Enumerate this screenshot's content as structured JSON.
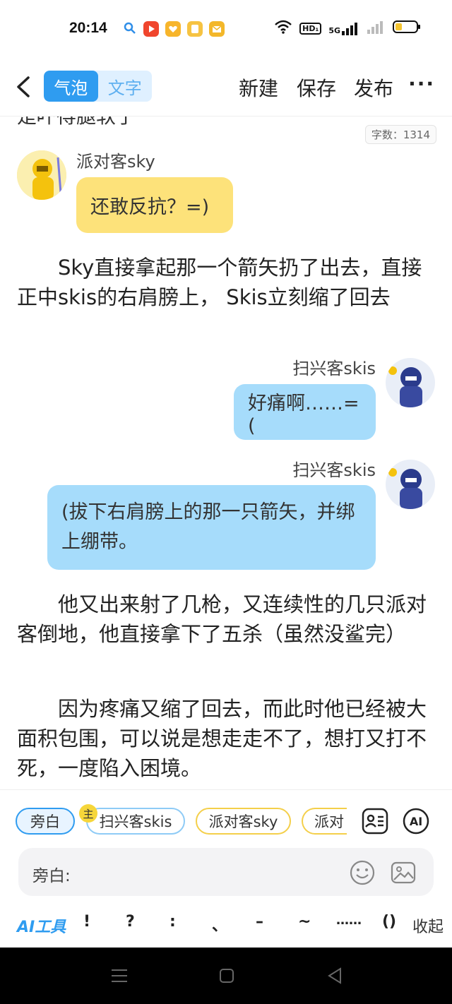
{
  "status": {
    "time": "20:14",
    "hd": "HD₁",
    "net": "5G"
  },
  "header": {
    "mode_bubble": "气泡",
    "mode_text": "文字",
    "new": "新建",
    "save": "保存",
    "publish": "发布",
    "more": "···"
  },
  "content": {
    "cut_line": "是吓得腿软了",
    "word_count": "字数：1314",
    "messages": [
      {
        "speaker": "派对客sky",
        "text": "还敢反抗？=)"
      },
      {
        "narration": "　　Sky直接拿起那一个箭矢扔了出去，直接正中skis的右肩膀上， Skis立刻缩了回去"
      },
      {
        "speaker": "扫兴客skis",
        "text": "好痛啊……=("
      },
      {
        "speaker": "扫兴客skis",
        "text": "(拔下右肩膀上的那一只箭矢，并绑上绷带。"
      },
      {
        "narration": "　　他又出来射了几枪，又连续性的几只派对客倒地，他直接拿下了五杀（虽然没鲨完）"
      },
      {
        "narration": "　　因为疼痛又缩了回去，而此时他已经被大面积包围，可以说是想走走不了，想打又打不死，一度陷入困境。"
      }
    ]
  },
  "panel": {
    "roles": [
      "旁白",
      "扫兴客skis",
      "派对客sky",
      "派对"
    ],
    "host_badge": "主",
    "input_label": "旁白:",
    "ai_tool": "AI工具",
    "punctuation": [
      "!",
      "?",
      ":",
      "、",
      "–",
      "~",
      "……",
      "()"
    ],
    "collapse": "收起",
    "ai_icon": "AI"
  },
  "colors": {
    "accent": "#2f9cf0",
    "sky_bubble": "#fde27a",
    "skis_bubble": "#a6dcfb"
  }
}
